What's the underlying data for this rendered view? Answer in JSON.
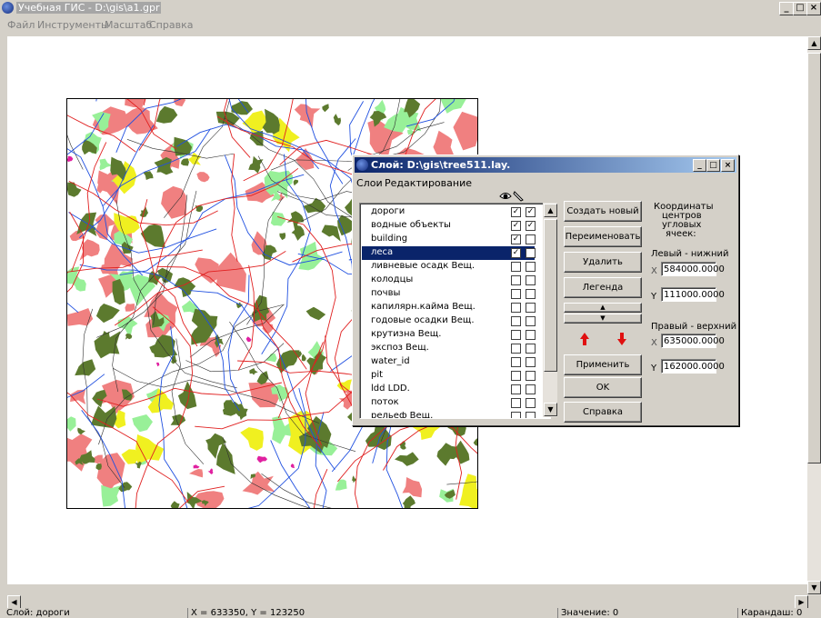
{
  "window": {
    "title": "Учебная ГИС - D:\\gis\\a1.gpr",
    "controls": {
      "minimize": "_",
      "maximize": "□",
      "close": "×"
    }
  },
  "menu": [
    "Файл",
    "Инструменты",
    "Масштаб",
    "Справка"
  ],
  "map": {
    "colors": {
      "forest": "#5c7a2e",
      "pink": "#f08080",
      "lightgreen": "#98f098",
      "yellow": "#f0f020",
      "magenta": "#e020a0",
      "road": "#e02020",
      "water": "#2050e0",
      "boundary": "#303030"
    }
  },
  "dialog": {
    "title": "Слой: D:\\gis\\tree511.lay.",
    "menu": [
      "Слои",
      "Редактирование"
    ],
    "layers": [
      {
        "name": "дороги",
        "visible": true,
        "edit": true
      },
      {
        "name": "водные объекты",
        "visible": true,
        "edit": true
      },
      {
        "name": "building",
        "visible": true,
        "edit": false
      },
      {
        "name": "леса",
        "visible": true,
        "edit": false,
        "selected": true
      },
      {
        "name": "ливневые осадк Вещ.",
        "visible": false,
        "edit": false
      },
      {
        "name": "колодцы",
        "visible": false,
        "edit": false
      },
      {
        "name": "почвы",
        "visible": false,
        "edit": false
      },
      {
        "name": "капилярн.кайма Вещ.",
        "visible": false,
        "edit": false
      },
      {
        "name": "годовые осадки Вещ.",
        "visible": false,
        "edit": false
      },
      {
        "name": "крутизна Вещ.",
        "visible": false,
        "edit": false
      },
      {
        "name": "экспоз Вещ.",
        "visible": false,
        "edit": false
      },
      {
        "name": "water_id",
        "visible": false,
        "edit": false
      },
      {
        "name": "pit",
        "visible": false,
        "edit": false
      },
      {
        "name": "ldd LDD.",
        "visible": false,
        "edit": false
      },
      {
        "name": "поток",
        "visible": false,
        "edit": false
      },
      {
        "name": "рельеф Вещ.",
        "visible": false,
        "edit": false
      }
    ],
    "buttons": {
      "create": "Создать новый",
      "rename": "Переименовать",
      "delete": "Удалить",
      "legend": "Легенда",
      "apply": "Применить",
      "ok": "OK",
      "help": "Справка"
    },
    "coords": {
      "header": [
        "Координаты",
        "центров",
        "угловых",
        "ячеек:"
      ],
      "lower_left_label": "Левый - нижний",
      "upper_right_label": "Правый - верхний",
      "x_label": "X",
      "y_label": "Y",
      "ll_x": "584000.0000",
      "ll_y": "111000.0000",
      "ur_x": "635000.0000",
      "ur_y": "162000.0000"
    }
  },
  "status": {
    "layer": "Слой: дороги",
    "coords": "X = 633350, Y = 123250",
    "value": "Значение: 0",
    "pencil": "Карандаш: 0"
  }
}
